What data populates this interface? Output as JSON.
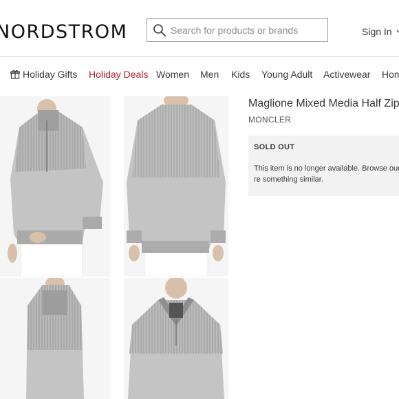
{
  "header": {
    "logo": "NORDSTROM",
    "search_placeholder": "Search for products or brands",
    "signin_label": "Sign In"
  },
  "nav": {
    "items": [
      "Holiday Gifts",
      "Holiday Deals",
      "Women",
      "Men",
      "Kids",
      "Young Adult",
      "Activewear",
      "Hom"
    ]
  },
  "product": {
    "title": "Maglione Mixed Media Half Zip S",
    "brand": "MONCLER",
    "sold_out_label": "SOLD OUT",
    "sold_out_message": "This item is no longer available. Browse our re something similar."
  },
  "colors": {
    "accent_deals": "#b21c2b",
    "text": "#393939",
    "sweater_gray": "#b8b8b8"
  }
}
